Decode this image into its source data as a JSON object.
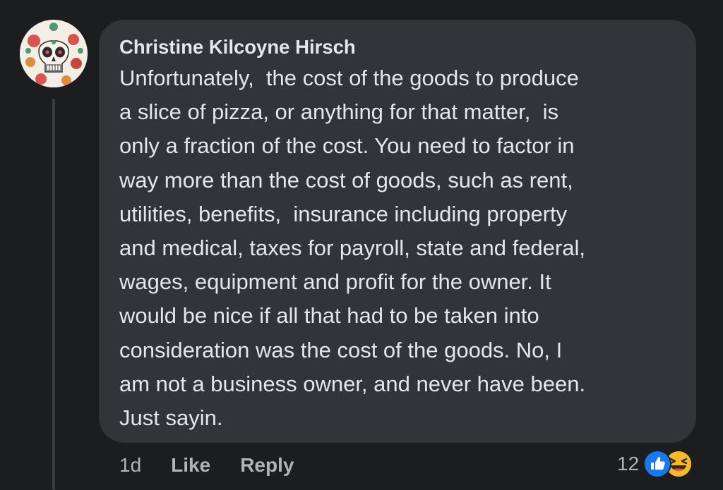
{
  "comment": {
    "author": "Christine Kilcoyne Hirsch",
    "text_lines": [
      "Unfortunately,  the cost of the goods to produce",
      "a slice of pizza, or anything for that matter,  is",
      "only a fraction of the cost. You need to factor in",
      "way more than the cost of goods, such as rent,",
      "utilities, benefits,  insurance including property",
      "and medical, taxes for payroll, state and federal,",
      "wages, equipment and profit for the owner. It",
      "would be nice if all that had to be taken into",
      "consideration was the cost of the goods. No, I",
      "am not a business owner, and never have been.",
      "Just sayin."
    ],
    "timestamp": "1d",
    "like_label": "Like",
    "reply_label": "Reply",
    "reaction_count": "12",
    "reactions": [
      "like-icon",
      "haha-icon"
    ]
  },
  "colors": {
    "background": "#1c1d1f",
    "bubble": "#333437",
    "text_primary": "#e4e6eb",
    "text_secondary": "#b0b3b8",
    "like_blue": "#1877f2",
    "haha_yellow": "#f7b928"
  }
}
